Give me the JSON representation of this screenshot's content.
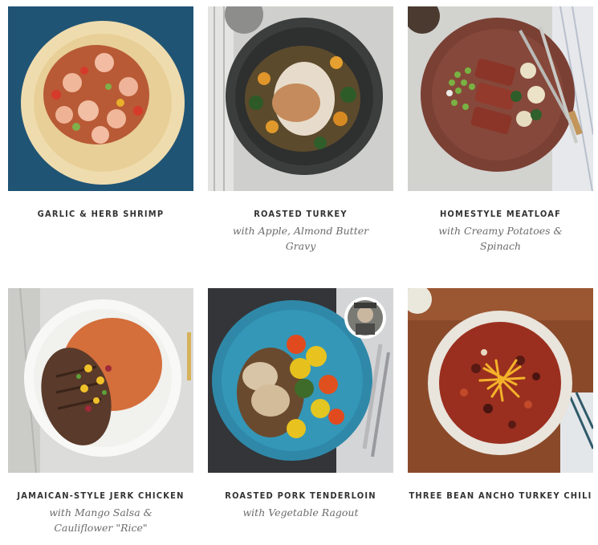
{
  "meals": [
    {
      "title": "GARLIC & HERB SHRIMP",
      "subtitle": "",
      "photo_icon": "shrimp-plate"
    },
    {
      "title": "ROASTED TURKEY",
      "subtitle": "with Apple, Almond Butter Gravy",
      "photo_icon": "turkey-plate"
    },
    {
      "title": "HOMESTYLE MEATLOAF",
      "subtitle": "with Creamy Potatoes & Spinach",
      "photo_icon": "meatloaf-plate"
    },
    {
      "title": "JAMAICAN-STYLE JERK CHICKEN",
      "subtitle": "with Mango Salsa & Cauliflower \"Rice\"",
      "photo_icon": "jerk-chicken-plate"
    },
    {
      "title": "ROASTED PORK TENDERLOIN",
      "subtitle": "with Vegetable Ragout",
      "photo_icon": "pork-plate"
    },
    {
      "title": "THREE BEAN ANCHO TURKEY CHILI",
      "subtitle": "",
      "photo_icon": "chili-bowl"
    }
  ],
  "colors": {
    "title_text": "#333333",
    "subtitle_text": "#6b6b6b"
  }
}
